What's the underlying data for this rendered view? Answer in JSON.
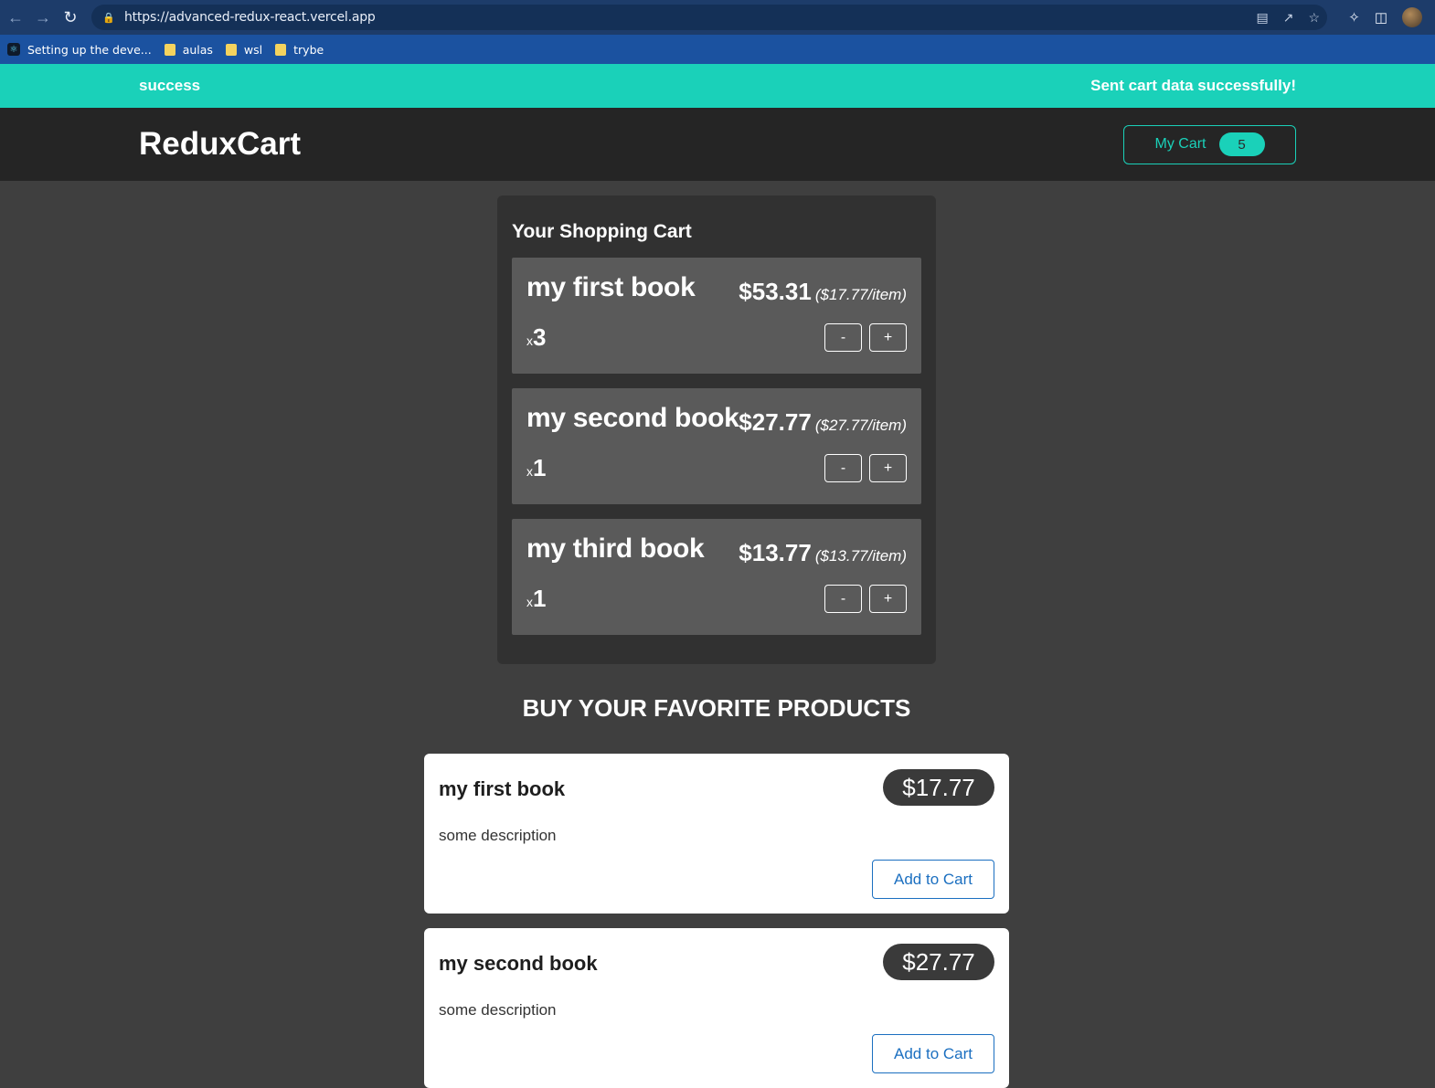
{
  "browser": {
    "url": "https://advanced-redux-react.vercel.app",
    "bookmarks": [
      {
        "label": "Setting up the deve...",
        "icon": "react-favicon-icon"
      },
      {
        "label": "aulas",
        "icon": "folder-icon"
      },
      {
        "label": "wsl",
        "icon": "folder-icon"
      },
      {
        "label": "trybe",
        "icon": "folder-icon"
      }
    ]
  },
  "notification": {
    "status": "success",
    "message": "Sent cart data successfully!",
    "color": "#1ad1b9"
  },
  "header": {
    "logo": "ReduxCart",
    "cart_button_label": "My Cart",
    "cart_count": "5"
  },
  "cart": {
    "title": "Your Shopping Cart",
    "items": [
      {
        "title": "my first book",
        "total": "$53.31",
        "per_item": "($17.77/item)",
        "x": "x",
        "quantity": "3",
        "minus": "-",
        "plus": "+"
      },
      {
        "title": "my second book",
        "total": "$27.77",
        "per_item": "($27.77/item)",
        "x": "x",
        "quantity": "1",
        "minus": "-",
        "plus": "+"
      },
      {
        "title": "my third book",
        "total": "$13.77",
        "per_item": "($13.77/item)",
        "x": "x",
        "quantity": "1",
        "minus": "-",
        "plus": "+"
      }
    ]
  },
  "products": {
    "heading": "BUY YOUR FAVORITE PRODUCTS",
    "items": [
      {
        "title": "my first book",
        "price": "$17.77",
        "description": "some description",
        "add_label": "Add to Cart"
      },
      {
        "title": "my second book",
        "price": "$27.77",
        "description": "some description",
        "add_label": "Add to Cart"
      }
    ]
  }
}
